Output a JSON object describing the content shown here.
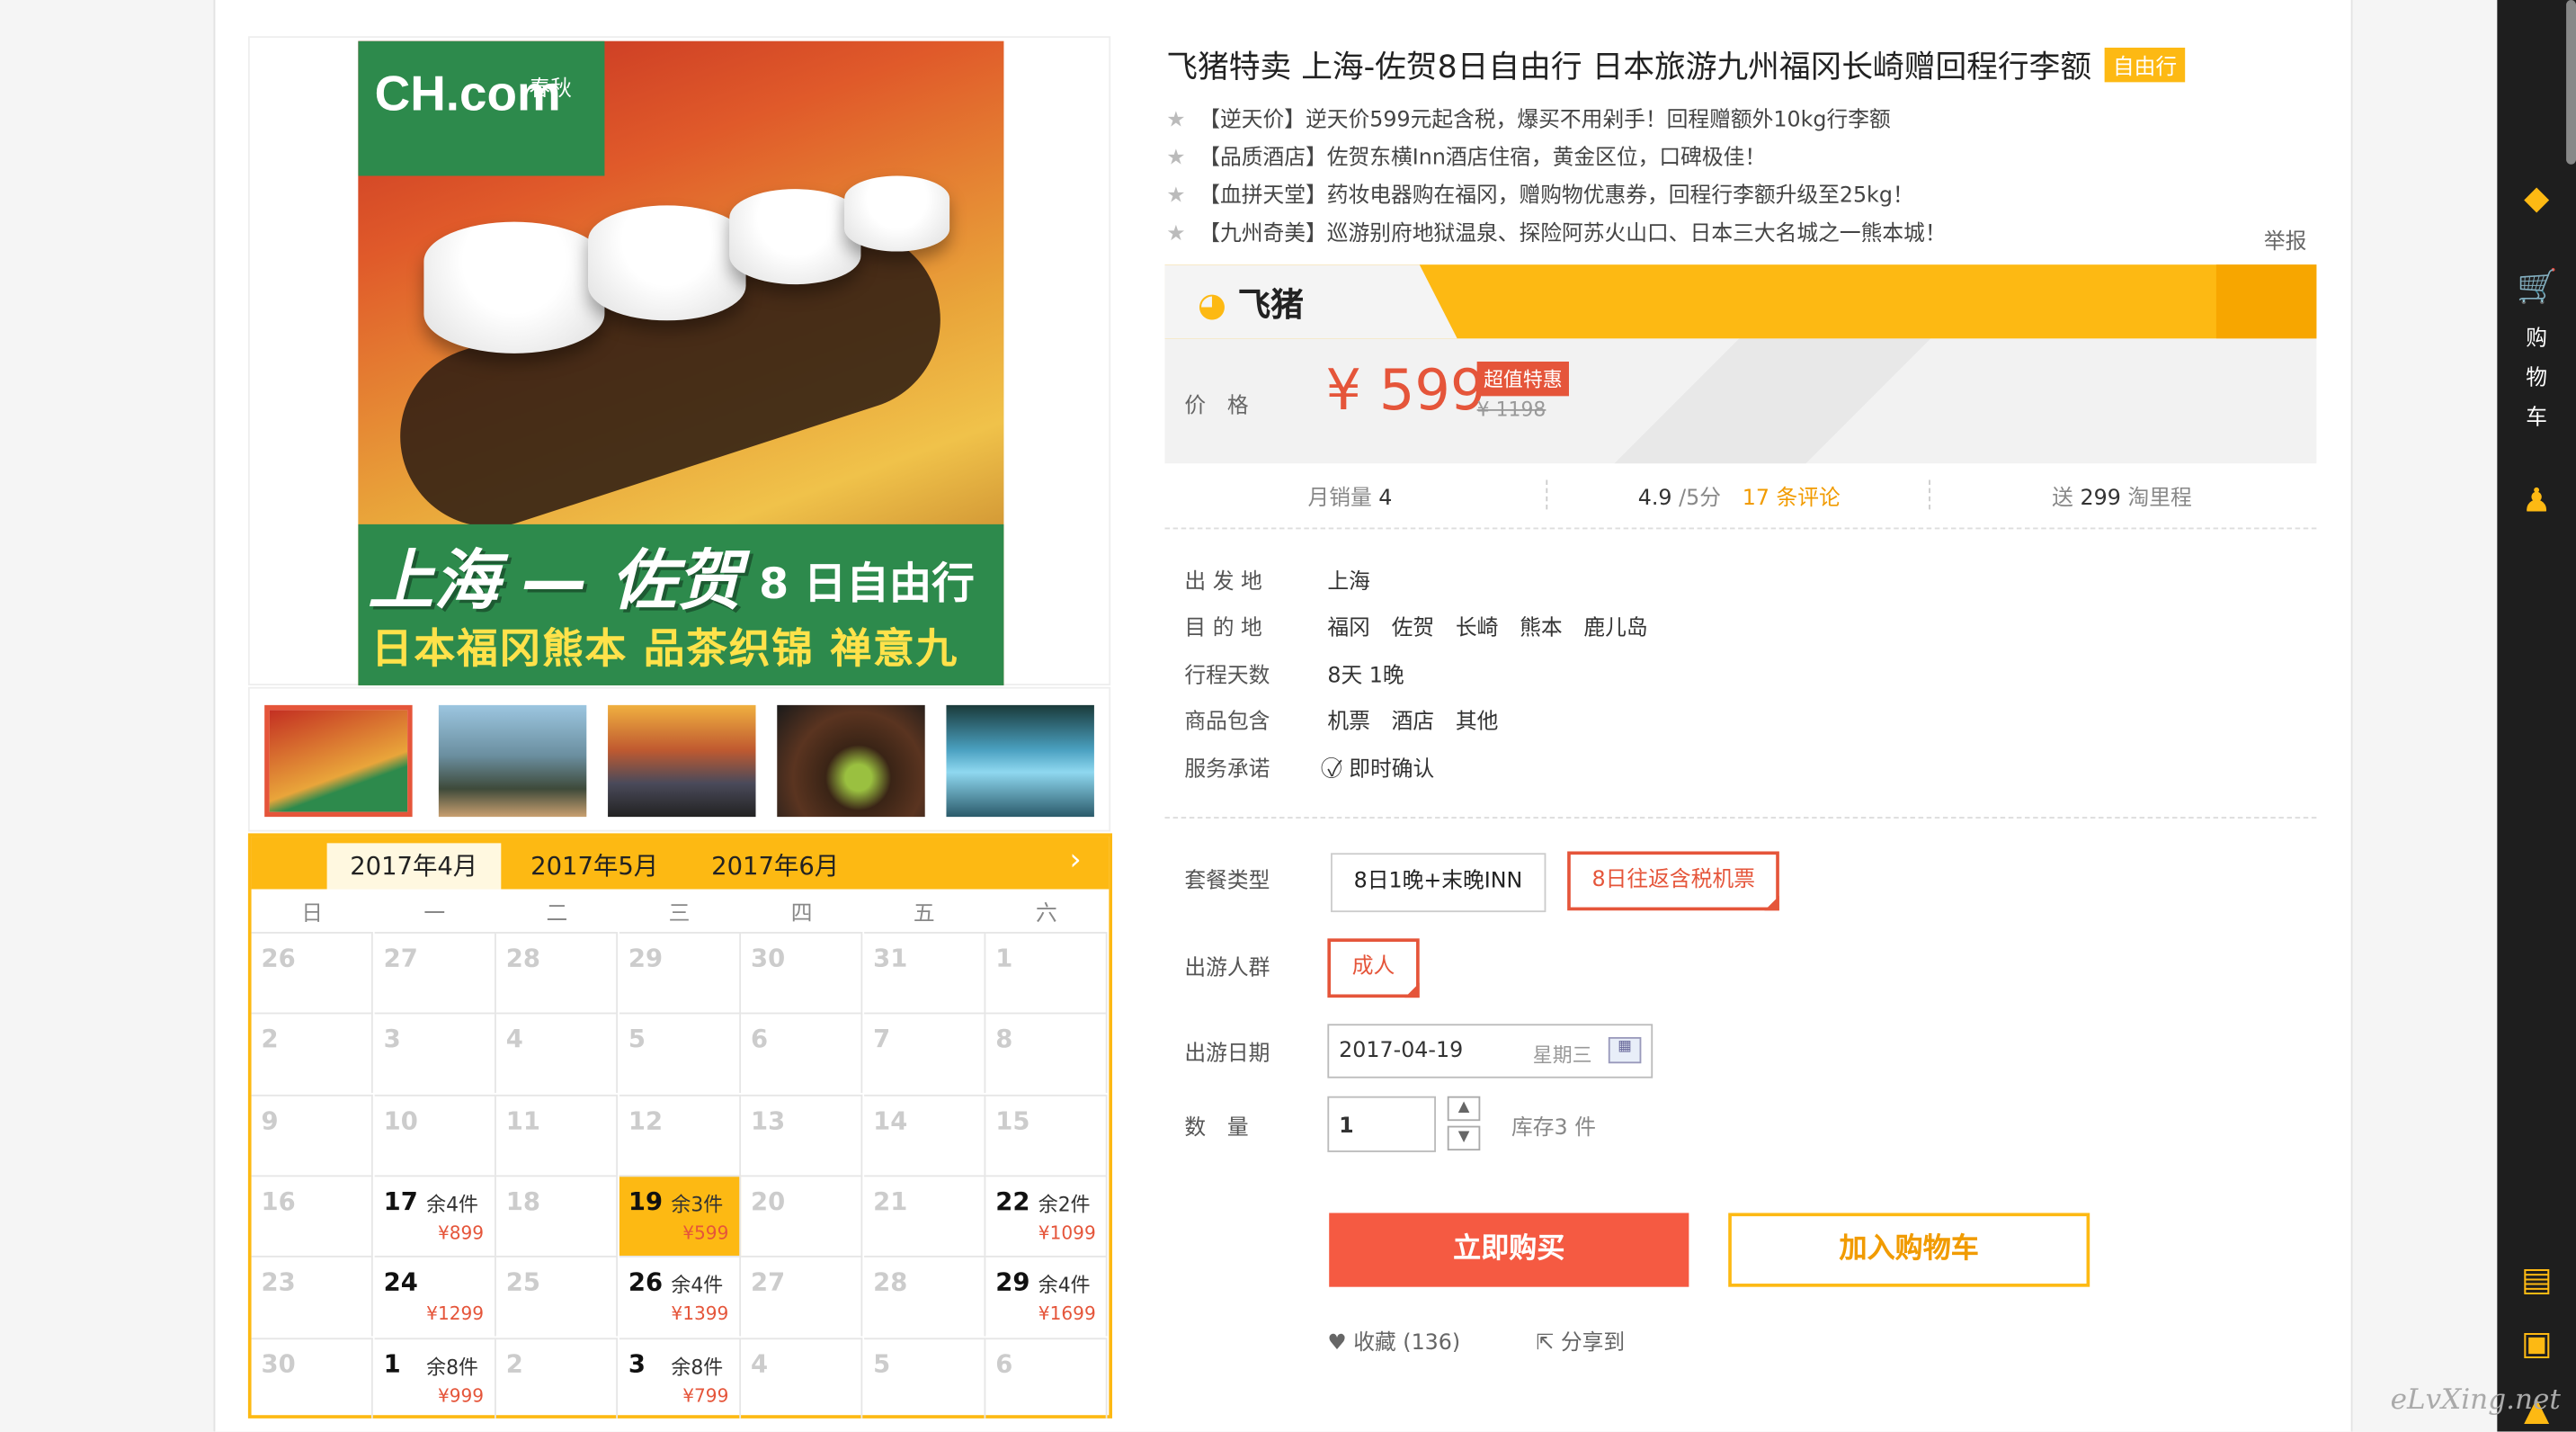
{
  "product": {
    "title": "飞猪特卖 上海-佐贺8日自由行 日本旅游九州福冈长崎赠回程行李额",
    "tag": "自由行",
    "features": [
      "【逆天价】逆天价599元起含税，爆买不用剁手！回程赠额外10kg行李额",
      "【品质酒店】佐贺东横Inn酒店住宿，黄金区位，口碑极佳！",
      "【血拼天堂】药妆电器购在福冈，赠购物优惠券，回程行李额升级至25kg！",
      "【九州奇美】巡游别府地狱温泉、探险阿苏火山口、日本三大名城之一熊本城！"
    ],
    "report": "举报"
  },
  "gallery": {
    "brand": "CH.com",
    "brand_sub": "春秋",
    "banner_title": "上海 — 佐贺",
    "banner_days": "8 日自由行",
    "banner_sub": "日本福冈熊本 品茶织锦 禅意九州"
  },
  "fliggy": {
    "logo": "飞猪",
    "price_label": "价　格",
    "price": "¥ 599",
    "deal_badge": "超值特惠",
    "orig_price": "¥ 1198"
  },
  "stats": {
    "monthly_label": "月销量",
    "monthly": "4",
    "rating": "4.9",
    "rating_scale": "/5分",
    "reviews": "17 条评论",
    "miles_label": "送",
    "miles": "299",
    "miles_unit": "淘里程"
  },
  "info": [
    {
      "label": "出 发 地",
      "value": "上海"
    },
    {
      "label": "目 的 地",
      "value": "福冈　佐贺　长崎　熊本　鹿儿岛"
    },
    {
      "label": "行程天数",
      "value": "8天 1晚"
    },
    {
      "label": "商品包含",
      "value": "机票　酒店　其他"
    },
    {
      "label": "服务承诺",
      "value": "即时确认"
    }
  ],
  "options": {
    "package_label": "套餐类型",
    "packages": [
      "8日1晚+末晚INN",
      "8日往返含税机票"
    ],
    "crowd_label": "出游人群",
    "crowd": "成人",
    "date_label": "出游日期",
    "date": "2017-04-19",
    "weekday": "星期三",
    "qty_label": "数　量",
    "qty": "1",
    "stock": "库存3 件"
  },
  "actions": {
    "buy": "立即购买",
    "cart": "加入购物车",
    "fav": "收藏 (136)",
    "share": "分享到"
  },
  "calendar": {
    "months": [
      "2017年4月",
      "2017年5月",
      "2017年6月"
    ],
    "weekdays": [
      "日",
      "一",
      "二",
      "三",
      "四",
      "五",
      "六"
    ],
    "rows": [
      [
        {
          "d": "26"
        },
        {
          "d": "27"
        },
        {
          "d": "28"
        },
        {
          "d": "29"
        },
        {
          "d": "30"
        },
        {
          "d": "31"
        },
        {
          "d": "1"
        }
      ],
      [
        {
          "d": "2"
        },
        {
          "d": "3"
        },
        {
          "d": "4"
        },
        {
          "d": "5"
        },
        {
          "d": "6"
        },
        {
          "d": "7"
        },
        {
          "d": "8"
        }
      ],
      [
        {
          "d": "9"
        },
        {
          "d": "10"
        },
        {
          "d": "11"
        },
        {
          "d": "12"
        },
        {
          "d": "13"
        },
        {
          "d": "14"
        },
        {
          "d": "15"
        }
      ],
      [
        {
          "d": "16"
        },
        {
          "d": "17",
          "rem": "余4件",
          "p": "¥899"
        },
        {
          "d": "18"
        },
        {
          "d": "19",
          "rem": "余3件",
          "p": "¥599",
          "sel": true
        },
        {
          "d": "20"
        },
        {
          "d": "21"
        },
        {
          "d": "22",
          "rem": "余2件",
          "p": "¥1099"
        }
      ],
      [
        {
          "d": "23"
        },
        {
          "d": "24",
          "p": "¥1299"
        },
        {
          "d": "25"
        },
        {
          "d": "26",
          "rem": "余4件",
          "p": "¥1399"
        },
        {
          "d": "27"
        },
        {
          "d": "28"
        },
        {
          "d": "29",
          "rem": "余4件",
          "p": "¥1699"
        }
      ],
      [
        {
          "d": "30"
        },
        {
          "d": "1",
          "rem": "余8件",
          "p": "¥999"
        },
        {
          "d": "2"
        },
        {
          "d": "3",
          "rem": "余8件",
          "p": "¥799"
        },
        {
          "d": "4"
        },
        {
          "d": "5"
        },
        {
          "d": "6"
        }
      ]
    ]
  },
  "sidebar": {
    "cart_label": [
      "购",
      "物",
      "车"
    ]
  },
  "watermark": "eLvXing.net"
}
